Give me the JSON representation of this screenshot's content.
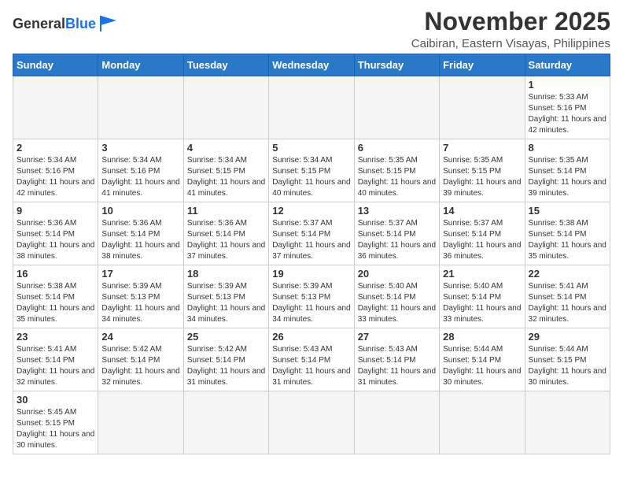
{
  "header": {
    "logo_general": "General",
    "logo_blue": "Blue",
    "month_year": "November 2025",
    "location": "Caibiran, Eastern Visayas, Philippines"
  },
  "days_of_week": [
    "Sunday",
    "Monday",
    "Tuesday",
    "Wednesday",
    "Thursday",
    "Friday",
    "Saturday"
  ],
  "weeks": [
    [
      {
        "day": null
      },
      {
        "day": null
      },
      {
        "day": null
      },
      {
        "day": null
      },
      {
        "day": null
      },
      {
        "day": null
      },
      {
        "day": "1",
        "sunrise": "5:33 AM",
        "sunset": "5:16 PM",
        "daylight": "11 hours and 42 minutes."
      }
    ],
    [
      {
        "day": "2",
        "sunrise": "5:34 AM",
        "sunset": "5:16 PM",
        "daylight": "11 hours and 42 minutes."
      },
      {
        "day": "3",
        "sunrise": "5:34 AM",
        "sunset": "5:16 PM",
        "daylight": "11 hours and 41 minutes."
      },
      {
        "day": "4",
        "sunrise": "5:34 AM",
        "sunset": "5:15 PM",
        "daylight": "11 hours and 41 minutes."
      },
      {
        "day": "5",
        "sunrise": "5:34 AM",
        "sunset": "5:15 PM",
        "daylight": "11 hours and 40 minutes."
      },
      {
        "day": "6",
        "sunrise": "5:35 AM",
        "sunset": "5:15 PM",
        "daylight": "11 hours and 40 minutes."
      },
      {
        "day": "7",
        "sunrise": "5:35 AM",
        "sunset": "5:15 PM",
        "daylight": "11 hours and 39 minutes."
      },
      {
        "day": "8",
        "sunrise": "5:35 AM",
        "sunset": "5:14 PM",
        "daylight": "11 hours and 39 minutes."
      }
    ],
    [
      {
        "day": "9",
        "sunrise": "5:36 AM",
        "sunset": "5:14 PM",
        "daylight": "11 hours and 38 minutes."
      },
      {
        "day": "10",
        "sunrise": "5:36 AM",
        "sunset": "5:14 PM",
        "daylight": "11 hours and 38 minutes."
      },
      {
        "day": "11",
        "sunrise": "5:36 AM",
        "sunset": "5:14 PM",
        "daylight": "11 hours and 37 minutes."
      },
      {
        "day": "12",
        "sunrise": "5:37 AM",
        "sunset": "5:14 PM",
        "daylight": "11 hours and 37 minutes."
      },
      {
        "day": "13",
        "sunrise": "5:37 AM",
        "sunset": "5:14 PM",
        "daylight": "11 hours and 36 minutes."
      },
      {
        "day": "14",
        "sunrise": "5:37 AM",
        "sunset": "5:14 PM",
        "daylight": "11 hours and 36 minutes."
      },
      {
        "day": "15",
        "sunrise": "5:38 AM",
        "sunset": "5:14 PM",
        "daylight": "11 hours and 35 minutes."
      }
    ],
    [
      {
        "day": "16",
        "sunrise": "5:38 AM",
        "sunset": "5:14 PM",
        "daylight": "11 hours and 35 minutes."
      },
      {
        "day": "17",
        "sunrise": "5:39 AM",
        "sunset": "5:13 PM",
        "daylight": "11 hours and 34 minutes."
      },
      {
        "day": "18",
        "sunrise": "5:39 AM",
        "sunset": "5:13 PM",
        "daylight": "11 hours and 34 minutes."
      },
      {
        "day": "19",
        "sunrise": "5:39 AM",
        "sunset": "5:13 PM",
        "daylight": "11 hours and 34 minutes."
      },
      {
        "day": "20",
        "sunrise": "5:40 AM",
        "sunset": "5:14 PM",
        "daylight": "11 hours and 33 minutes."
      },
      {
        "day": "21",
        "sunrise": "5:40 AM",
        "sunset": "5:14 PM",
        "daylight": "11 hours and 33 minutes."
      },
      {
        "day": "22",
        "sunrise": "5:41 AM",
        "sunset": "5:14 PM",
        "daylight": "11 hours and 32 minutes."
      }
    ],
    [
      {
        "day": "23",
        "sunrise": "5:41 AM",
        "sunset": "5:14 PM",
        "daylight": "11 hours and 32 minutes."
      },
      {
        "day": "24",
        "sunrise": "5:42 AM",
        "sunset": "5:14 PM",
        "daylight": "11 hours and 32 minutes."
      },
      {
        "day": "25",
        "sunrise": "5:42 AM",
        "sunset": "5:14 PM",
        "daylight": "11 hours and 31 minutes."
      },
      {
        "day": "26",
        "sunrise": "5:43 AM",
        "sunset": "5:14 PM",
        "daylight": "11 hours and 31 minutes."
      },
      {
        "day": "27",
        "sunrise": "5:43 AM",
        "sunset": "5:14 PM",
        "daylight": "11 hours and 31 minutes."
      },
      {
        "day": "28",
        "sunrise": "5:44 AM",
        "sunset": "5:14 PM",
        "daylight": "11 hours and 30 minutes."
      },
      {
        "day": "29",
        "sunrise": "5:44 AM",
        "sunset": "5:15 PM",
        "daylight": "11 hours and 30 minutes."
      }
    ],
    [
      {
        "day": "30",
        "sunrise": "5:45 AM",
        "sunset": "5:15 PM",
        "daylight": "11 hours and 30 minutes."
      },
      {
        "day": null
      },
      {
        "day": null
      },
      {
        "day": null
      },
      {
        "day": null
      },
      {
        "day": null
      },
      {
        "day": null
      }
    ]
  ],
  "labels": {
    "sunrise": "Sunrise:",
    "sunset": "Sunset:",
    "daylight": "Daylight:"
  }
}
